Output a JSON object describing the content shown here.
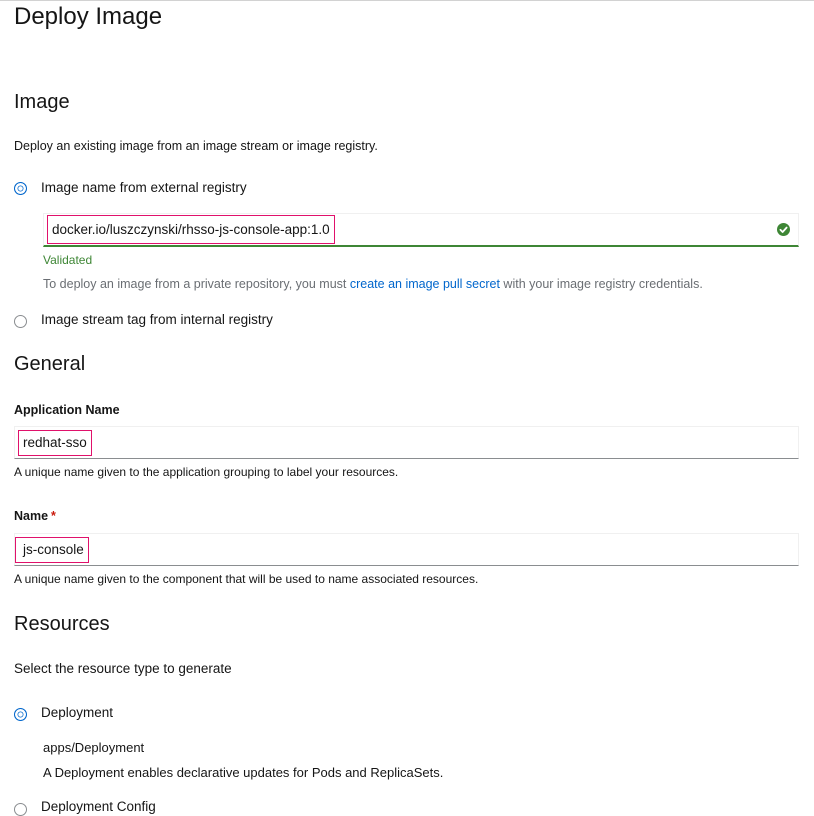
{
  "page": {
    "title": "Deploy Image"
  },
  "image_section": {
    "title": "Image",
    "description": "Deploy an existing image from an image stream or image registry.",
    "option_external": "Image name from external registry",
    "image_value": "docker.io/luszczynski/rhsso-js-console-app:1.0",
    "validated_text": "Validated",
    "help_prefix": "To deploy an image from a private repository, you must ",
    "help_link": "create an image pull secret",
    "help_suffix": " with your image registry credentials.",
    "option_internal": "Image stream tag from internal registry"
  },
  "general_section": {
    "title": "General",
    "app_name_label": "Application Name",
    "app_name_value": "redhat-sso",
    "app_name_help": "A unique name given to the application grouping to label your resources.",
    "name_label": "Name",
    "name_required": "*",
    "name_value": "js-console",
    "name_help": "A unique name given to the component that will be used to name associated resources."
  },
  "resources_section": {
    "title": "Resources",
    "description": "Select the resource type to generate",
    "option_deployment": "Deployment",
    "deployment_api": "apps/Deployment",
    "deployment_desc": "A Deployment enables declarative updates for Pods and ReplicaSets.",
    "option_deployment_config": "Deployment Config"
  },
  "colors": {
    "accent": "#0066cc",
    "success": "#3e8635",
    "highlight": "#e0116b",
    "required": "#c9190b"
  }
}
